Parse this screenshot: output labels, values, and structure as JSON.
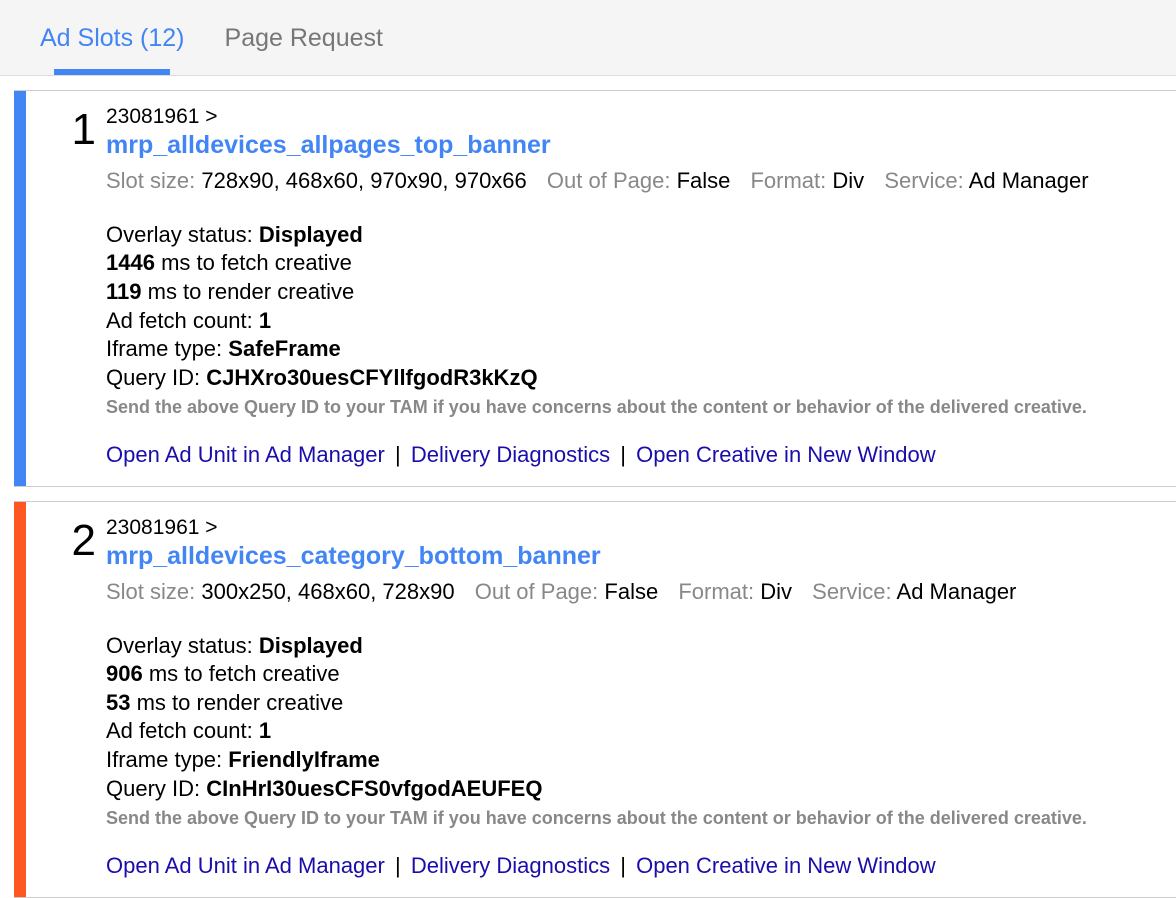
{
  "tabs": {
    "ad_slots": "Ad Slots (12)",
    "page_request": "Page Request"
  },
  "hint_text": "Send the above Query ID to your TAM if you have concerns about the content or behavior of the delivered creative.",
  "labels": {
    "slot_size": "Slot size:",
    "out_of_page": "Out of Page:",
    "format": "Format:",
    "service": "Service:",
    "overlay_status": "Overlay status:",
    "fetch_ms_suffix": " ms to fetch creative",
    "render_ms_suffix": " ms to render creative",
    "ad_fetch_count": "Ad fetch count:",
    "iframe_type": "Iframe type:",
    "query_id": "Query ID:"
  },
  "link_labels": {
    "open_ad_unit": "Open Ad Unit in Ad Manager",
    "delivery_diag": "Delivery Diagnostics",
    "open_creative": "Open Creative in New Window"
  },
  "slots": [
    {
      "num": "1",
      "bar_color": "#4285f4",
      "network_path": "23081961 >",
      "ad_unit": "mrp_alldevices_allpages_top_banner",
      "slot_size": "728x90, 468x60, 970x90, 970x66",
      "out_of_page": "False",
      "format": "Div",
      "service": "Ad Manager",
      "overlay_status": "Displayed",
      "fetch_ms": "1446",
      "render_ms": "119",
      "ad_fetch_count": "1",
      "iframe_type": "SafeFrame",
      "query_id": "CJHXro30uesCFYllfgodR3kKzQ"
    },
    {
      "num": "2",
      "bar_color": "#ff5722",
      "network_path": "23081961 >",
      "ad_unit": "mrp_alldevices_category_bottom_banner",
      "slot_size": "300x250, 468x60, 728x90",
      "out_of_page": "False",
      "format": "Div",
      "service": "Ad Manager",
      "overlay_status": "Displayed",
      "fetch_ms": "906",
      "render_ms": "53",
      "ad_fetch_count": "1",
      "iframe_type": "FriendlyIframe",
      "query_id": "CInHrI30uesCFS0vfgodAEUFEQ"
    }
  ]
}
